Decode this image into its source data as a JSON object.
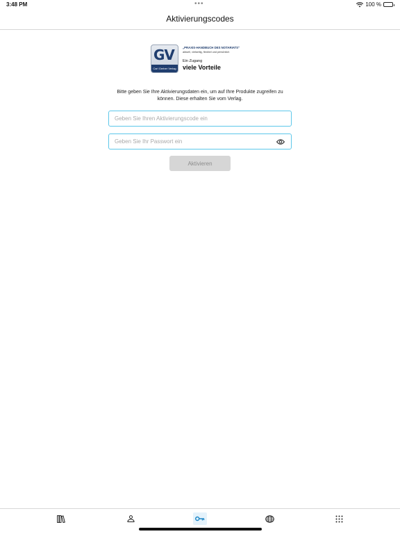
{
  "status_bar": {
    "time": "3:48 PM",
    "dots": "•••",
    "battery": "100 %"
  },
  "header": {
    "title": "Aktivierungscodes"
  },
  "logo": {
    "mark": "GV",
    "publisher": "Carl Gerber Verlag",
    "line1": "„PRAXIS-HANDBUCH DES NOTARIATS“",
    "line2": "aktuell, vielseitig, flexibel und persönlich",
    "line3": "Ein Zugang",
    "line4": "viele Vorteile"
  },
  "info": {
    "text": "Bitte geben Sie Ihre Aktivierungsdaten ein, um auf Ihre Produkte zugreifen zu können. Diese erhalten Sie vom Verlag."
  },
  "form": {
    "code_placeholder": "Geben Sie Ihren Aktivierungscode ein",
    "code_value": "",
    "password_placeholder": "Geben Sie Ihr Passwort ein",
    "password_value": "",
    "activate_label": "Aktivieren"
  },
  "tabs": [
    {
      "icon": "library-icon",
      "active": false
    },
    {
      "icon": "profile-icon",
      "active": false
    },
    {
      "icon": "key-icon",
      "active": true
    },
    {
      "icon": "globe-icon",
      "active": false
    },
    {
      "icon": "grid-icon",
      "active": false
    }
  ],
  "colors": {
    "accent": "#5cc7ea",
    "active_tab_bg": "#e4f2fb",
    "button_disabled": "#d6d6d6"
  }
}
